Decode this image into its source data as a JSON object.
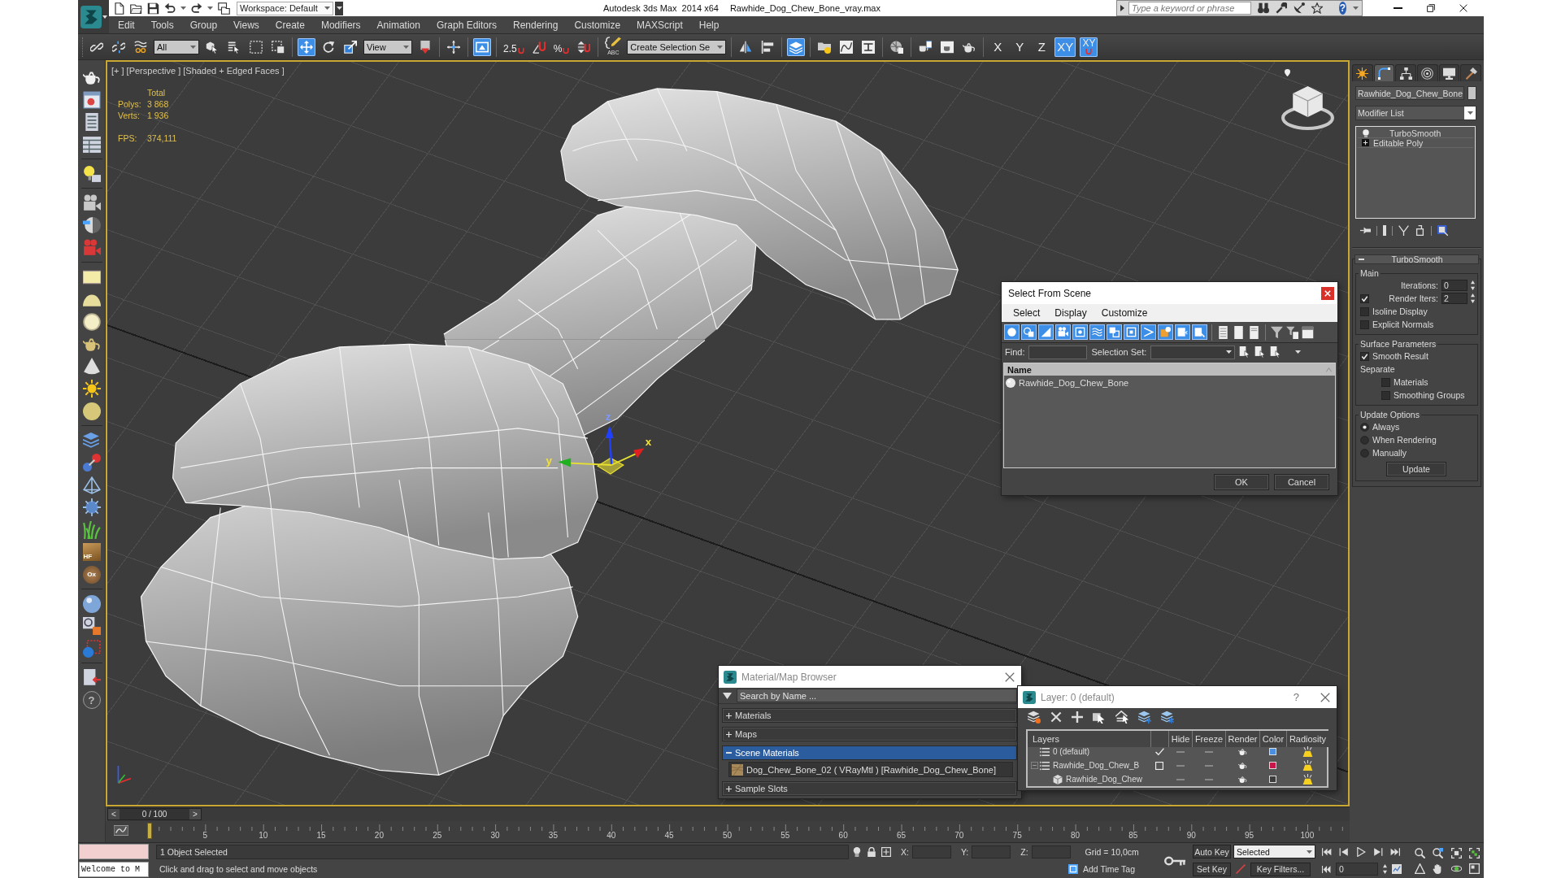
{
  "title_bar": {
    "workspace": "Workspace: Default",
    "app_title": "Autodesk 3ds Max  2014 x64",
    "file_name": "Rawhide_Dog_Chew_Bone_vray.max",
    "search": {
      "placeholder": "Type a keyword or phrase"
    },
    "help_button": "?"
  },
  "menu_bar": [
    "Edit",
    "Tools",
    "Group",
    "Views",
    "Create",
    "Modifiers",
    "Animation",
    "Graph Editors",
    "Rendering",
    "Customize",
    "MAXScript",
    "Help"
  ],
  "main_toolbar": [
    {
      "kind": "icon",
      "active": false
    },
    {
      "kind": "icon",
      "active": false
    },
    {
      "kind": "icon",
      "active": false
    },
    {
      "kind": "dropdown",
      "value": "All"
    },
    {
      "kind": "icon",
      "active": false
    },
    {
      "kind": "icon",
      "active": false
    },
    {
      "kind": "icon",
      "active": false
    },
    {
      "kind": "icon",
      "active": false
    },
    {
      "kind": "icon",
      "active": true
    },
    {
      "kind": "icon",
      "active": false
    },
    {
      "kind": "icon",
      "active": false
    },
    {
      "kind": "dropdown",
      "value": "View"
    },
    {
      "kind": "icon",
      "active": false
    },
    {
      "kind": "icon",
      "active": false
    },
    {
      "kind": "icon",
      "active": true
    },
    {
      "kind": "snap",
      "label": "2.5",
      "active": false
    },
    {
      "kind": "icon",
      "active": false
    },
    {
      "kind": "snap",
      "label": "%",
      "active": false
    },
    {
      "kind": "icon",
      "active": false
    },
    {
      "kind": "named_sets",
      "label": "ABC"
    },
    {
      "kind": "dropdown",
      "value": "Create Selection Se"
    },
    {
      "kind": "icon",
      "active": false
    },
    {
      "kind": "icon",
      "active": false
    },
    {
      "kind": "icon",
      "active": true
    },
    {
      "kind": "icon",
      "active": false
    },
    {
      "kind": "icon",
      "active": false
    },
    {
      "kind": "icon",
      "active": false
    },
    {
      "kind": "icon",
      "active": false
    },
    {
      "kind": "icon",
      "active": false
    },
    {
      "kind": "icon",
      "active": false
    },
    {
      "kind": "icon",
      "active": false
    },
    {
      "kind": "axis",
      "label": "X",
      "active": false
    },
    {
      "kind": "axis",
      "label": "Y",
      "active": false
    },
    {
      "kind": "axis",
      "label": "Z",
      "active": false
    },
    {
      "kind": "axis",
      "label": "XY",
      "active": true
    },
    {
      "kind": "axis_snap",
      "label": "XY",
      "active": true
    }
  ],
  "left_toolbar": [
    {
      "kind": "icon"
    },
    {
      "kind": "icon"
    },
    {
      "kind": "icon"
    },
    {
      "kind": "icon"
    },
    {
      "kind": "icon"
    },
    {
      "kind": "icon"
    },
    {
      "kind": "icon"
    },
    {
      "kind": "icon"
    },
    {
      "kind": "icon"
    },
    {
      "kind": "icon"
    },
    {
      "kind": "icon"
    },
    {
      "kind": "icon"
    },
    {
      "kind": "icon"
    },
    {
      "kind": "icon"
    },
    {
      "kind": "icon"
    },
    {
      "kind": "icon"
    },
    {
      "kind": "icon"
    },
    {
      "kind": "icon"
    },
    {
      "kind": "icon"
    },
    {
      "kind": "icon"
    },
    {
      "kind": "labeled",
      "label": "HF"
    },
    {
      "kind": "labeled",
      "label": "Ox"
    },
    {
      "kind": "icon"
    },
    {
      "kind": "icon"
    },
    {
      "kind": "icon"
    },
    {
      "kind": "icon"
    },
    {
      "kind": "labeled",
      "label": "?"
    }
  ],
  "viewport": {
    "active": true,
    "labels": [
      "[+ ]",
      "[Perspective ]",
      "[Shaded + Edged Faces ]"
    ],
    "stats": {
      "header": "Total",
      "rows": [
        {
          "label": "Polys:",
          "value": "3 868"
        },
        {
          "label": "Verts:",
          "value": "1 936"
        }
      ],
      "fps": {
        "label": "FPS:",
        "value": "374,111"
      }
    },
    "gizmo_axes": [
      "z",
      "x",
      "y"
    ]
  },
  "select_from_scene": {
    "title": "Select From Scene",
    "menu": [
      "Select",
      "Display",
      "Customize"
    ],
    "filters": [
      {
        "active": true
      },
      {
        "active": true
      },
      {
        "active": true
      },
      {
        "active": true
      },
      {
        "active": true
      },
      {
        "active": true
      },
      {
        "active": true
      },
      {
        "active": true
      },
      {
        "active": true
      },
      {
        "active": true
      },
      {
        "active": true
      },
      {
        "active": true
      }
    ],
    "find": {
      "label": "Find:"
    },
    "selection_set": {
      "label": "Selection Set:"
    },
    "columns": [
      "Name"
    ],
    "rows": [
      {
        "name": "Rawhide_Dog_Chew_Bone"
      }
    ],
    "buttons": [
      "OK",
      "Cancel"
    ]
  },
  "material_browser": {
    "title": "Material/Map Browser",
    "search": {
      "placeholder": "Search by Name ..."
    },
    "sections": [
      {
        "label": "Materials",
        "expanded": false,
        "selected": false
      },
      {
        "label": "Maps",
        "expanded": false,
        "selected": false
      },
      {
        "label": "Scene Materials",
        "expanded": true,
        "selected": true,
        "children": [
          {
            "label": "Dog_Chew_Bone_02 ( VRayMtl ) [Rawhide_Dog_Chew_Bone]"
          }
        ]
      },
      {
        "label": "Sample Slots",
        "expanded": false,
        "selected": false
      }
    ]
  },
  "layer_dialog": {
    "title": "Layer: 0 (default)",
    "help_button": "?",
    "columns": [
      "Layers",
      "Hide",
      "Freeze",
      "Render",
      "Color",
      "Radiosity"
    ],
    "rows": [
      {
        "name": "0 (default)",
        "current": true,
        "hidden": false,
        "frozen": false,
        "renderable": true,
        "radiosity": true,
        "color": "#4a8fe0"
      },
      {
        "name": "Rawhide_Dog_Chew_B",
        "current": false,
        "hidden": false,
        "frozen": false,
        "renderable": true,
        "radiosity": true,
        "color": "#c8154a",
        "expanded": true,
        "children": [
          {
            "name": "Rawhide_Dog_Chew",
            "hidden": false,
            "frozen": false,
            "renderable": true,
            "radiosity": true,
            "color": "#3c3c3c"
          }
        ]
      }
    ]
  },
  "command_panel": {
    "tabs": [
      {
        "selected": false
      },
      {
        "selected": true
      },
      {
        "selected": false
      },
      {
        "selected": false
      },
      {
        "selected": false
      },
      {
        "selected": false
      }
    ],
    "object_name": "Rawhide_Dog_Chew_Bone",
    "modifier_list": "Modifier List",
    "modifier_stack": [
      {
        "kind": "modifier",
        "label": "TurboSmooth"
      },
      {
        "kind": "base_object",
        "label": "Editable Poly"
      }
    ],
    "rollout": {
      "title": "TurboSmooth",
      "expanded": true,
      "groups": [
        {
          "title": "Main",
          "controls": [
            {
              "kind": "spinner",
              "label": "Iterations:",
              "value": "0"
            },
            {
              "kind": "check_spinner",
              "label": "Render Iters:",
              "value": "2",
              "checked": true
            },
            {
              "kind": "checkbox",
              "label": "Isoline Display",
              "checked": false
            },
            {
              "kind": "checkbox",
              "label": "Explicit Normals",
              "checked": false
            }
          ]
        },
        {
          "title": "Surface Parameters",
          "controls": [
            {
              "kind": "checkbox",
              "label": "Smooth Result",
              "checked": true
            },
            {
              "kind": "label",
              "label": "Separate",
              "children": [
                {
                  "kind": "checkbox",
                  "label": "Materials",
                  "checked": false
                },
                {
                  "kind": "checkbox",
                  "label": "Smoothing Groups",
                  "checked": false
                }
              ]
            }
          ]
        },
        {
          "title": "Update Options",
          "controls": [
            {
              "kind": "radio",
              "label": "Always",
              "selected": true
            },
            {
              "kind": "radio",
              "label": "When Rendering",
              "selected": false
            },
            {
              "kind": "radio",
              "label": "Manually",
              "selected": false
            },
            {
              "kind": "button",
              "label": "Update"
            }
          ]
        }
      ]
    }
  },
  "time_slider": {
    "prev": "<",
    "position": "0 / 100",
    "next": ">",
    "level": 0
  },
  "track_bar": {
    "labels": [
      "5",
      "10",
      "15",
      "20",
      "25",
      "30",
      "35",
      "40",
      "45",
      "50",
      "55",
      "60",
      "65",
      "70",
      "75",
      "80",
      "85",
      "90",
      "95",
      "100"
    ]
  },
  "status_bar": {
    "listener_output": "Welcome to M",
    "selection_info": "1 Object Selected",
    "prompt": "Click and drag to select and move objects",
    "coordinates": [
      {
        "label": "X:"
      },
      {
        "label": "Y:"
      },
      {
        "label": "Z:"
      }
    ],
    "grid": "Grid = 10,0cm",
    "add_time_tag": "Add Time Tag",
    "auto_key": {
      "label": "Auto Key",
      "on": false
    },
    "key_mode": "Selected",
    "set_key": "Set Key",
    "key_filters": "Key Filters...",
    "frame": "0"
  }
}
